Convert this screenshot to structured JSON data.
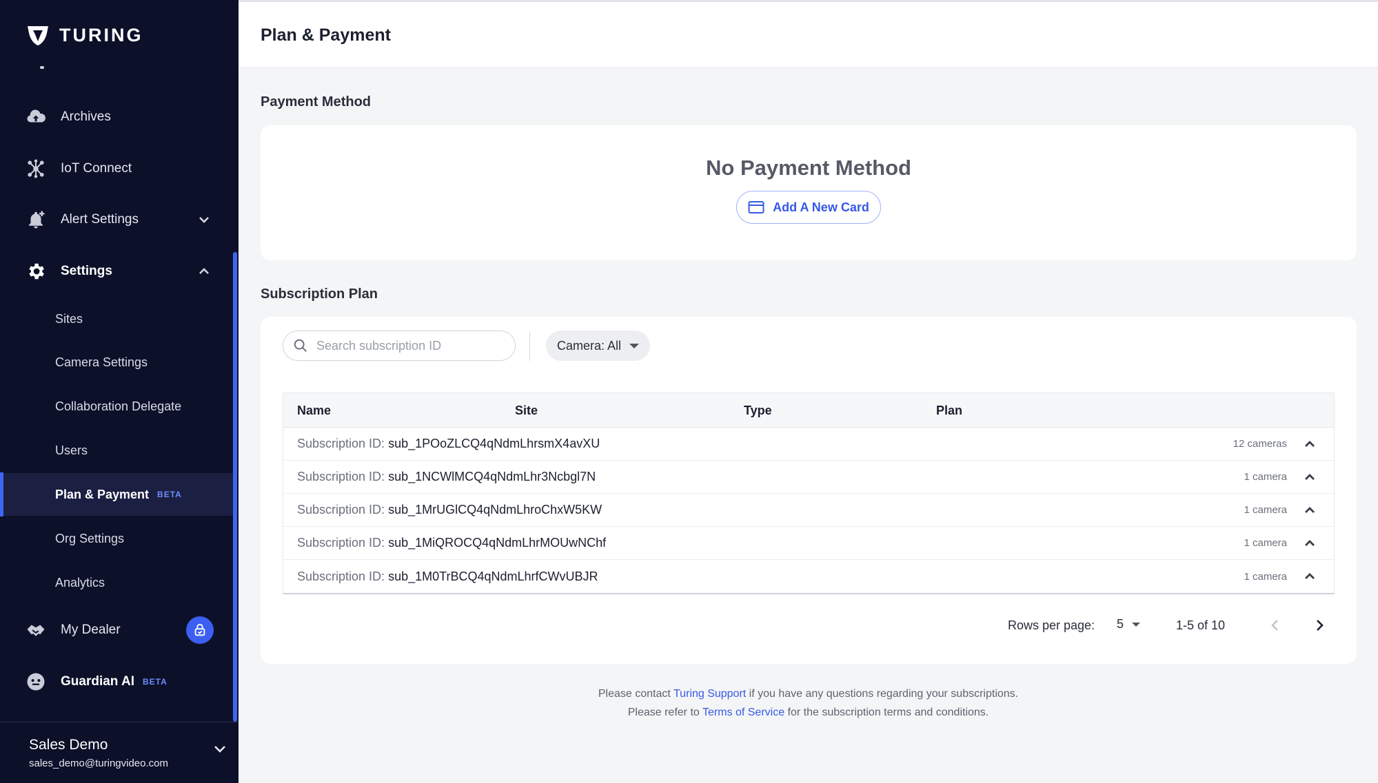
{
  "brand": {
    "name": "TURING"
  },
  "sidebar": {
    "items": [
      {
        "label": "Archives",
        "icon": "cloud-upload-icon"
      },
      {
        "label": "IoT Connect",
        "icon": "network-icon"
      },
      {
        "label": "Alert Settings",
        "icon": "bell-plus-icon"
      },
      {
        "label": "Settings",
        "icon": "gear-icon"
      }
    ],
    "settings_sub": [
      "Sites",
      "Camera Settings",
      "Collaboration Delegate",
      "Users",
      "Plan & Payment",
      "Org Settings",
      "Analytics"
    ],
    "beta_tag": "BETA",
    "my_dealer": "My Dealer",
    "guardian_ai": "Guardian AI",
    "account": {
      "name": "Sales Demo",
      "email": "sales_demo@turingvideo.com"
    }
  },
  "header": {
    "title": "Plan & Payment"
  },
  "payment": {
    "section_title": "Payment Method",
    "empty_text": "No Payment Method",
    "add_card_label": "Add A New Card"
  },
  "subscription": {
    "section_title": "Subscription Plan",
    "search_placeholder": "Search subscription ID",
    "filter_label": "Camera: All",
    "columns": [
      "Name",
      "Site",
      "Type",
      "Plan"
    ],
    "id_prefix": "Subscription ID:",
    "rows": [
      {
        "id": "sub_1POoZLCQ4qNdmLhrsmX4avXU",
        "count": "12 cameras"
      },
      {
        "id": "sub_1NCWlMCQ4qNdmLhr3Ncbgl7N",
        "count": "1 camera"
      },
      {
        "id": "sub_1MrUGlCQ4qNdmLhroChxW5KW",
        "count": "1 camera"
      },
      {
        "id": "sub_1MiQROCQ4qNdmLhrMOUwNChf",
        "count": "1 camera"
      },
      {
        "id": "sub_1M0TrBCQ4qNdmLhrfCWvUBJR",
        "count": "1 camera"
      }
    ],
    "rows_per_page_label": "Rows per page:",
    "rows_per_page": "5",
    "range": "1-5 of 10"
  },
  "footer": {
    "line1_pre": "Please contact ",
    "line1_link": "Turing Support",
    "line1_post": " if you have any questions regarding your subscriptions.",
    "line2_pre": "Please refer to ",
    "line2_link": "Terms of Service",
    "line2_post": " for the subscription terms and conditions."
  },
  "colors": {
    "sidebar_bg": "#0c1029",
    "accent": "#3f66f2",
    "link": "#3558e6"
  }
}
